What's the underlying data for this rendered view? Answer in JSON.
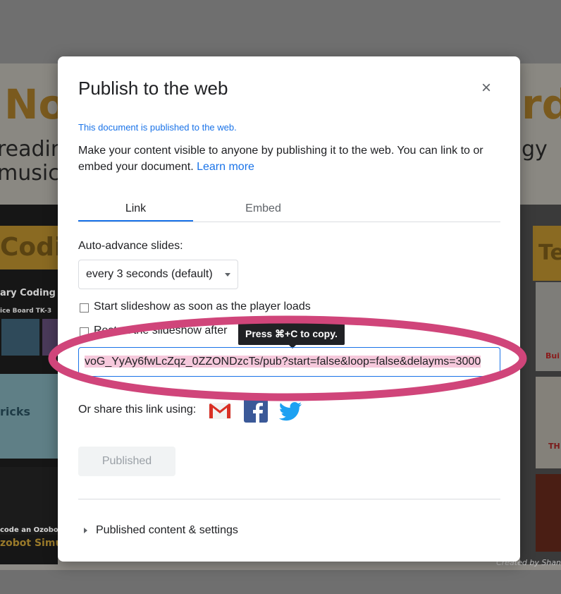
{
  "background": {
    "big_text_left": "No",
    "big_text_right": "rd",
    "line1_left": "readin",
    "line1_right": "gy",
    "line2_left": "music",
    "section_left": "Codi",
    "section_right": "Te",
    "tile1_title": "ary Coding C",
    "tile1_sub": "ice Board TK-3",
    "tile2_text": "ricks",
    "tile3_text": "code an Ozobot",
    "tile3_title": "zobot Simu",
    "right_small": "Bui",
    "right_small2": "TH",
    "credit": "Created by Shan"
  },
  "dialog": {
    "title": "Publish to the web",
    "close_icon": "×",
    "published_note": "This document is published to the web.",
    "description": "Make your content visible to anyone by publishing it to the web. You can link to or embed your document.",
    "learn_more": "Learn more",
    "tabs": [
      {
        "label": "Link",
        "active": true
      },
      {
        "label": "Embed",
        "active": false
      }
    ],
    "auto_advance_label": "Auto-advance slides:",
    "auto_advance_value": "every 3 seconds (default)",
    "checkbox_start": "Start slideshow as soon as the player loads",
    "checkbox_restart": "Restart the slideshow after",
    "tooltip": "Press ⌘+C to copy.",
    "link_value": "voG_YyAy6fwLcZqz_0ZZONDzcTs/pub?start=false&loop=false&delayms=3000",
    "share_label": "Or share this link using:",
    "share_icons": [
      "gmail-icon",
      "facebook-icon",
      "twitter-icon"
    ],
    "published_button": "Published",
    "settings_label": "Published content & settings"
  },
  "colors": {
    "accent": "#1a73e8",
    "annotation": "#d0457a",
    "gmail": "#d93025",
    "facebook": "#3b5998",
    "twitter": "#1da1f2"
  }
}
